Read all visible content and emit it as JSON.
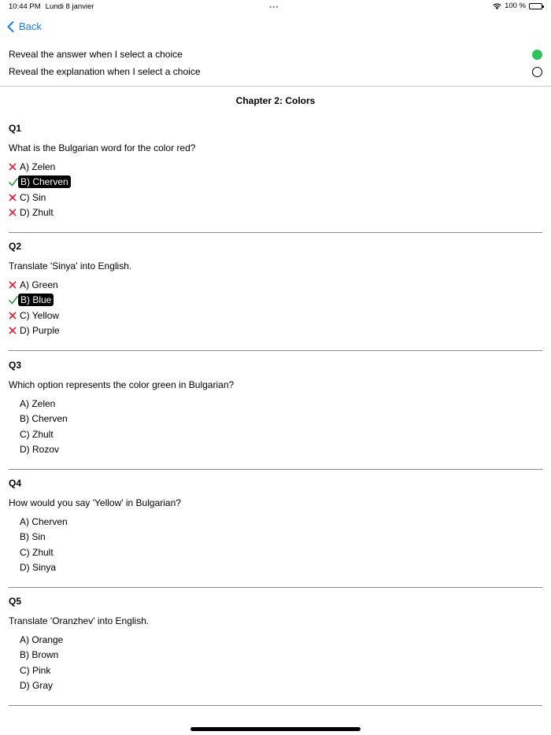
{
  "status_bar": {
    "time": "10:44 PM",
    "date": "Lundi 8 janvier",
    "battery": "100 %"
  },
  "nav": {
    "back_label": "Back"
  },
  "settings": [
    {
      "label": "Reveal the answer when I select a choice",
      "enabled": true
    },
    {
      "label": "Reveal the explanation when I select a choice",
      "enabled": false
    }
  ],
  "chapter_title": "Chapter 2: Colors",
  "questions": [
    {
      "title": "Q1",
      "text": "What is the Bulgarian word for the color red?",
      "choices": [
        {
          "label": "A) Zelen",
          "state": "wrong"
        },
        {
          "label": "B) Cherven",
          "state": "correct-selected"
        },
        {
          "label": "C) Sin",
          "state": "wrong"
        },
        {
          "label": "D) Zhult",
          "state": "wrong"
        }
      ]
    },
    {
      "title": "Q2",
      "text": "Translate 'Sinya' into English.",
      "choices": [
        {
          "label": "A) Green",
          "state": "wrong"
        },
        {
          "label": "B) Blue",
          "state": "correct-selected"
        },
        {
          "label": "C) Yellow",
          "state": "wrong"
        },
        {
          "label": "D) Purple",
          "state": "wrong"
        }
      ]
    },
    {
      "title": "Q3",
      "text": "Which option represents the color green in Bulgarian?",
      "choices": [
        {
          "label": "A) Zelen",
          "state": "none"
        },
        {
          "label": "B) Cherven",
          "state": "none"
        },
        {
          "label": "C) Zhult",
          "state": "none"
        },
        {
          "label": "D) Rozov",
          "state": "none"
        }
      ]
    },
    {
      "title": "Q4",
      "text": "How would you say 'Yellow' in Bulgarian?",
      "choices": [
        {
          "label": "A) Cherven",
          "state": "none"
        },
        {
          "label": "B) Sin",
          "state": "none"
        },
        {
          "label": "C) Zhult",
          "state": "none"
        },
        {
          "label": "D) Sinya",
          "state": "none"
        }
      ]
    },
    {
      "title": "Q5",
      "text": "Translate 'Oranzhev' into English.",
      "choices": [
        {
          "label": "A) Orange",
          "state": "none"
        },
        {
          "label": "B) Brown",
          "state": "none"
        },
        {
          "label": "C) Pink",
          "state": "none"
        },
        {
          "label": "D) Gray",
          "state": "none"
        }
      ]
    }
  ],
  "colors": {
    "accent": "#1a7cf2",
    "toggle_on": "#2fc35a",
    "correct": "#2e9a3f",
    "wrong": "#e0263a"
  },
  "icons": {
    "correct": "checkmark-icon",
    "wrong": "cross-icon"
  }
}
